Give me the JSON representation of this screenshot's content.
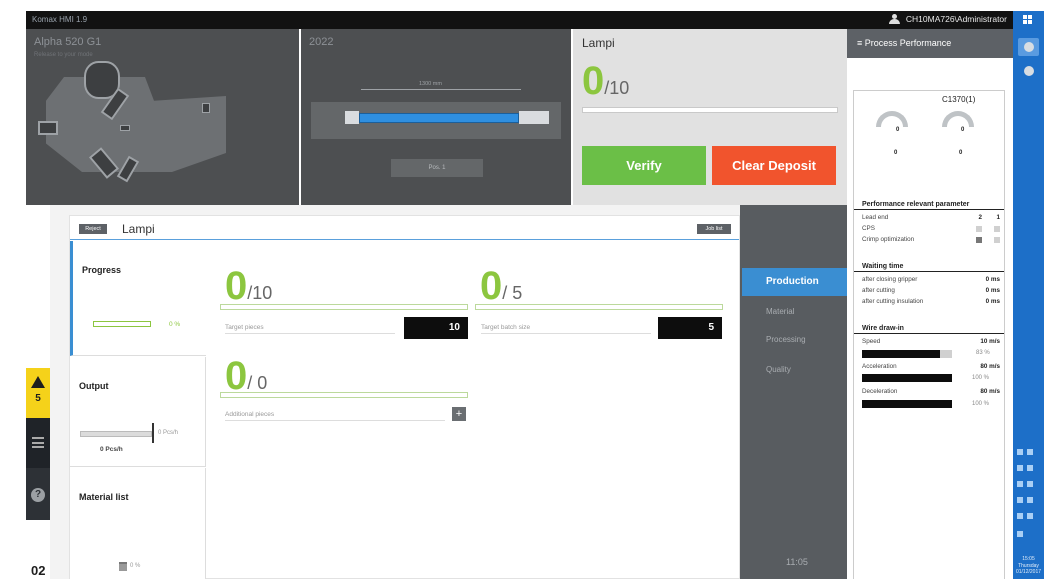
{
  "topbar": {
    "app_title": "Komax HMI 1.9",
    "user": "CH10MA726\\Administrator"
  },
  "machine_panel": {
    "title": "Alpha 520 G1",
    "subtitle": "Release to your mode"
  },
  "cable_panel": {
    "title": "2022",
    "dimension": "1300 mm",
    "pos_button": "Pos. 1"
  },
  "lampi_panel": {
    "title": "Lampi",
    "count": "0",
    "total": "/10",
    "verify_button": "Verify",
    "clear_button": "Clear Deposit"
  },
  "left_rail": {
    "warning_count": "5",
    "figure_label": "02"
  },
  "job_card": {
    "reject_button": "Reject",
    "title": "Lampi",
    "job_list_button": "Job list",
    "sections": {
      "progress": {
        "title": "Progress",
        "percent": "0 %"
      },
      "output": {
        "title": "Output",
        "pcs_label": "0 Pcs/h",
        "value": "0 Pcs/h"
      },
      "material": {
        "title": "Material list",
        "percent": "0 %"
      }
    },
    "counters": [
      {
        "count": "0",
        "total": "/10",
        "label": "Target pieces",
        "value": "10"
      },
      {
        "count": "0",
        "total": "/ 5",
        "label": "Target batch size",
        "value": "5"
      },
      {
        "count": "0",
        "total": "/ 0",
        "label": "Additional pieces",
        "value": ""
      }
    ]
  },
  "side_tabs": {
    "items": [
      "Production",
      "Material",
      "Processing",
      "Quality"
    ],
    "active": "Production",
    "clock": "11:05"
  },
  "performance": {
    "header": "Process Performance",
    "machine_id": "C1370(1)",
    "gauges": [
      {
        "center": "0",
        "value": "0"
      },
      {
        "center": "0",
        "value": "0"
      }
    ],
    "relevant_title": "Performance relevant parameter",
    "relevant_rows": [
      {
        "label": "Lead end",
        "a": "2",
        "b": "1"
      },
      {
        "label": "CPS",
        "a": "",
        "b": ""
      },
      {
        "label": "Crimp optimization",
        "a": "",
        "b": ""
      }
    ],
    "waiting_title": "Waiting time",
    "waiting_rows": [
      {
        "label": "after closing gripper",
        "value": "0 ms"
      },
      {
        "label": "after cutting",
        "value": "0 ms"
      },
      {
        "label": "after cutting insulation",
        "value": "0 ms"
      }
    ],
    "wire_title": "Wire draw-in",
    "wire_rows": [
      {
        "label": "Speed",
        "value": "10 m/s",
        "pct": "83 %"
      },
      {
        "label": "Acceleration",
        "value": "80 m/s",
        "pct": "100 %"
      },
      {
        "label": "Deceleration",
        "value": "80 m/s",
        "pct": "100 %"
      }
    ]
  },
  "taskbar": {
    "time": "15:05",
    "day": "Thursday",
    "date": "01/12/2017"
  },
  "colors": {
    "accent_blue": "#3a8ed2",
    "progress_green": "#8cc63f",
    "verify_green": "#6bbf47",
    "clear_red": "#f1542d",
    "warning_yellow": "#f5d21a",
    "taskbar_blue": "#1d6fc8"
  }
}
